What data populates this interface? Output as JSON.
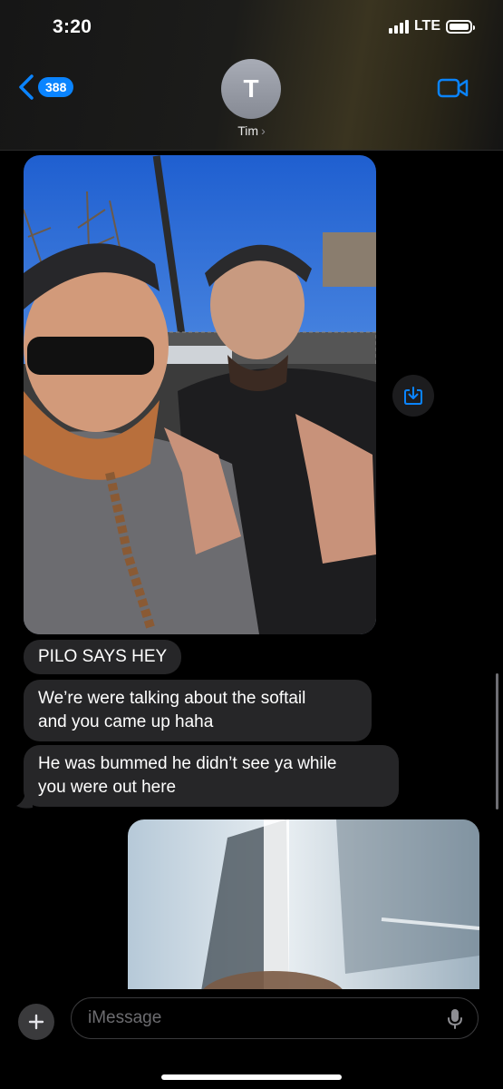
{
  "status_bar": {
    "time": "3:20",
    "network": "LTE"
  },
  "header": {
    "unread_count": "388",
    "avatar_initial": "T",
    "contact_name": "Tim",
    "contact_chevron": "›"
  },
  "messages": [
    {
      "type": "image",
      "from": "them",
      "description_icon": "photo"
    },
    {
      "type": "text",
      "from": "them",
      "text": "PILO SAYS HEY"
    },
    {
      "type": "text",
      "from": "them",
      "lines": [
        "We’re were talking about the softail",
        "and you came up haha"
      ]
    },
    {
      "type": "text",
      "from": "them",
      "lines": [
        "He was bummed he didn’t see ya while",
        "you were out here"
      ]
    },
    {
      "type": "image",
      "from": "me",
      "description_icon": "photo"
    }
  ],
  "input": {
    "placeholder": "iMessage"
  },
  "colors": {
    "accent": "#0a84ff",
    "bubble_incoming": "#262628",
    "background": "#000000"
  }
}
